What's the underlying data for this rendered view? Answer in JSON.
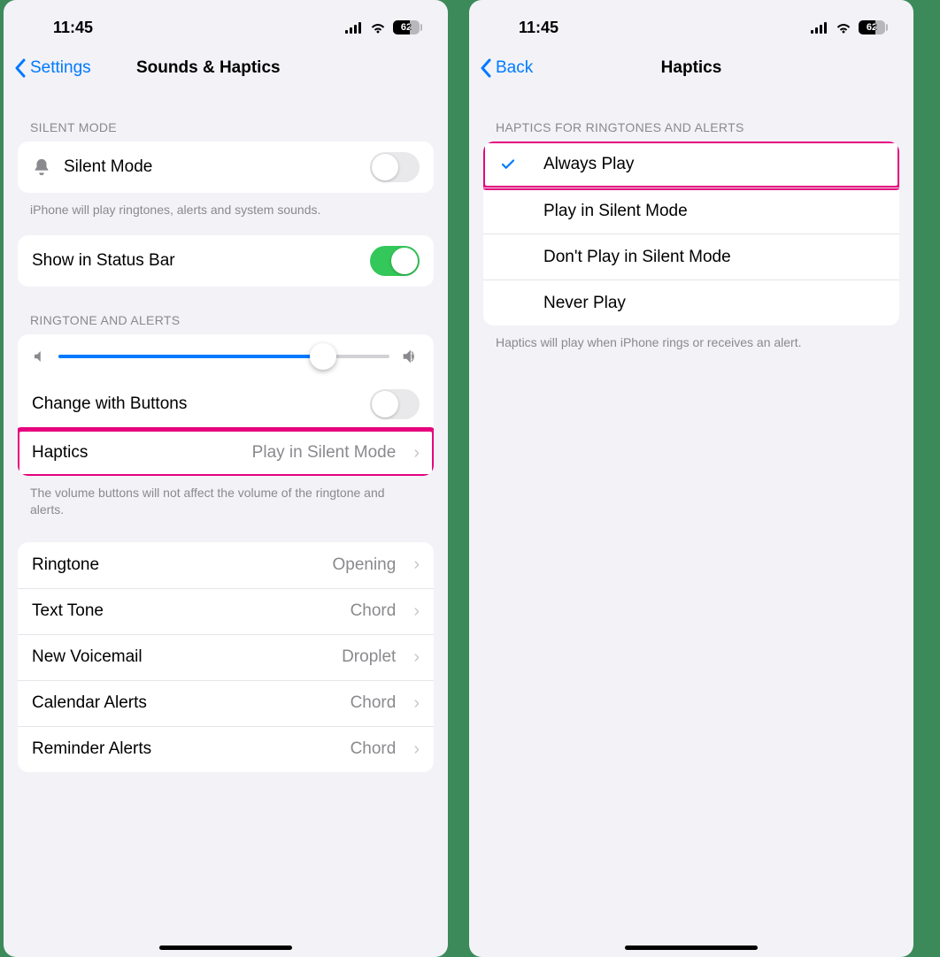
{
  "status": {
    "time": "11:45",
    "battery": "62"
  },
  "left": {
    "back": "Settings",
    "title": "Sounds & Haptics",
    "section_silent_header": "SILENT MODE",
    "silent_mode_label": "Silent Mode",
    "silent_footer": "iPhone will play ringtones, alerts and system sounds.",
    "show_status_label": "Show in Status Bar",
    "section_ringtone_header": "RINGTONE AND ALERTS",
    "change_buttons_label": "Change with Buttons",
    "haptics_label": "Haptics",
    "haptics_value": "Play in Silent Mode",
    "ringtone_footer": "The volume buttons will not affect the volume of the ringtone and alerts.",
    "sounds": [
      {
        "label": "Ringtone",
        "value": "Opening"
      },
      {
        "label": "Text Tone",
        "value": "Chord"
      },
      {
        "label": "New Voicemail",
        "value": "Droplet"
      },
      {
        "label": "Calendar Alerts",
        "value": "Chord"
      },
      {
        "label": "Reminder Alerts",
        "value": "Chord"
      }
    ]
  },
  "right": {
    "back": "Back",
    "title": "Haptics",
    "section_header": "HAPTICS FOR RINGTONES AND ALERTS",
    "options": [
      {
        "label": "Always Play",
        "selected": true
      },
      {
        "label": "Play in Silent Mode",
        "selected": false
      },
      {
        "label": "Don't Play in Silent Mode",
        "selected": false
      },
      {
        "label": "Never Play",
        "selected": false
      }
    ],
    "footer": "Haptics will play when iPhone rings or receives an alert."
  }
}
